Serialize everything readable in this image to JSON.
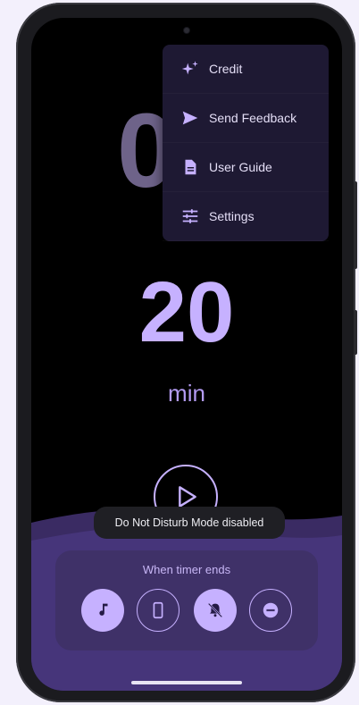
{
  "menu": {
    "items": [
      {
        "label": "Credit",
        "icon": "sparkle-icon"
      },
      {
        "label": "Send Feedback",
        "icon": "send-icon"
      },
      {
        "label": "User Guide",
        "icon": "document-icon"
      },
      {
        "label": "Settings",
        "icon": "tune-icon"
      }
    ]
  },
  "background_digit": "0",
  "timer": {
    "value": "20",
    "unit": "min"
  },
  "play": {
    "icon": "play-icon"
  },
  "toast": {
    "text": "Do Not Disturb Mode disabled"
  },
  "timer_end": {
    "title": "When timer ends",
    "options": [
      {
        "icon": "music-note-icon",
        "selected": true
      },
      {
        "icon": "phone-vibrate-icon",
        "selected": false
      },
      {
        "icon": "bell-off-icon",
        "selected": true
      },
      {
        "icon": "do-not-disturb-icon",
        "selected": false
      }
    ]
  },
  "colors": {
    "accent": "#c6b1ff",
    "panel": "#3f3168",
    "menu_bg": "#1e1933",
    "screen_bg": "#000000"
  }
}
